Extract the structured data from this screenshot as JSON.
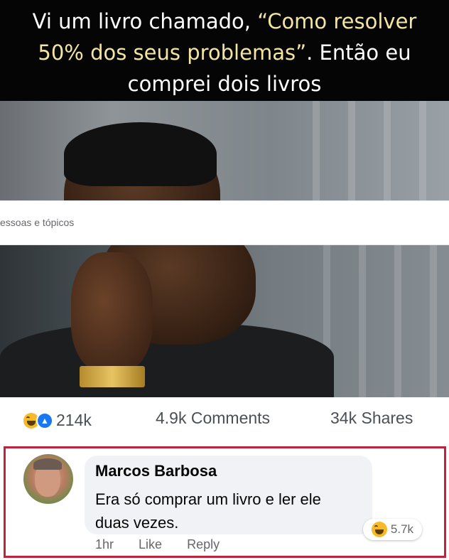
{
  "meme": {
    "line1": "Vi um livro chamado, ",
    "line1_highlight": "“Como resolver",
    "line2_highlight": "50% dos seus problemas”",
    "line2_rest": ". Então eu",
    "line3": "comprei dois livros"
  },
  "search": {
    "placeholder_fragment": "essoas e tópicos"
  },
  "post_stats": {
    "reaction_count": "214k",
    "comments": "4.9k Comments",
    "shares": "34k Shares"
  },
  "comment": {
    "author": "Marcos Barbosa",
    "text": "Era só comprar um livro e ler ele duas vezes.",
    "reaction_count": "5.7k",
    "time": "1hr",
    "like_label": "Like",
    "reply_label": "Reply"
  },
  "colors": {
    "caption_bg": "#050505",
    "caption_highlight": "#f3e6a2",
    "comment_border": "#c0243a",
    "like_blue": "#1877f2",
    "haha_yellow": "#f7b928"
  },
  "icons": [
    "haha-reaction-icon",
    "like-reaction-icon"
  ]
}
